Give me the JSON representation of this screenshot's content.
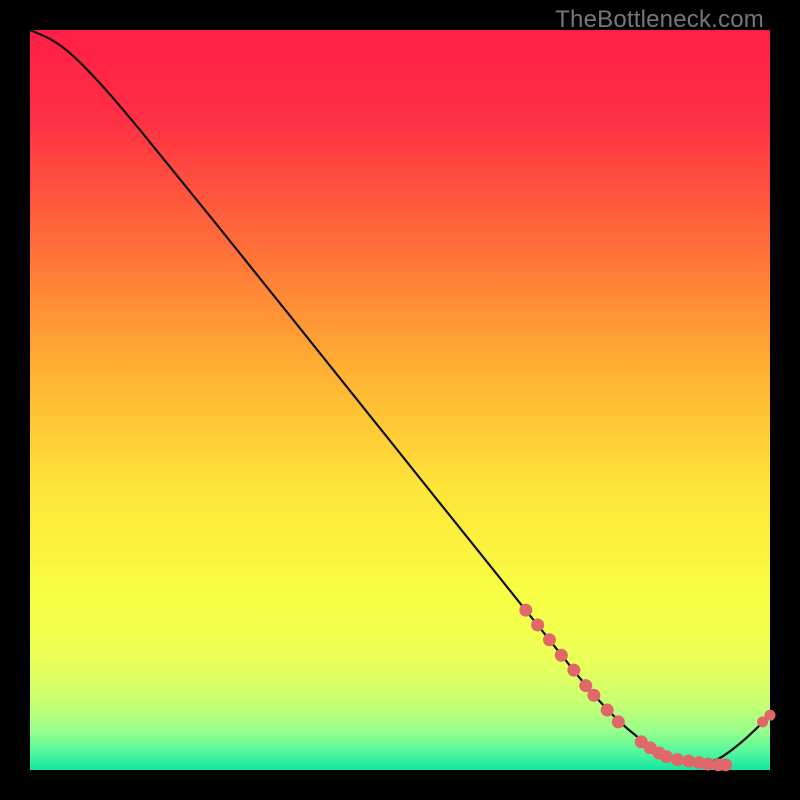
{
  "watermark": "TheBottleneck.com",
  "chart_data": {
    "type": "line",
    "title": "",
    "xlabel": "",
    "ylabel": "",
    "xlim": [
      0,
      100
    ],
    "ylim": [
      0,
      100
    ],
    "series": [
      {
        "name": "curve",
        "x": [
          0,
          3.5,
          7,
          12,
          20,
          30,
          40,
          50,
          60,
          67,
          72,
          76,
          80,
          84,
          88,
          92,
          96,
          100
        ],
        "y": [
          100,
          98.5,
          95.5,
          90,
          80.2,
          67.8,
          55.3,
          42.8,
          30.3,
          21.6,
          15.3,
          10.3,
          6.1,
          3.0,
          1.2,
          0.7,
          3.5,
          7.4
        ]
      }
    ],
    "markers_dense": {
      "name": "dense-cluster",
      "x": [
        67.0,
        68.6,
        70.2,
        71.8,
        73.5,
        75.1,
        76.2,
        78.0,
        79.5,
        82.6,
        83.8,
        85.0,
        86.0,
        87.5,
        89.0,
        90.4,
        91.6,
        93.0,
        94.0
      ],
      "y": [
        21.6,
        19.6,
        17.6,
        15.5,
        13.5,
        11.4,
        10.1,
        8.1,
        6.5,
        3.8,
        3.0,
        2.3,
        1.8,
        1.4,
        1.2,
        1.0,
        0.8,
        0.7,
        0.7
      ]
    },
    "markers_tail": {
      "name": "tail-points",
      "x": [
        99.0,
        100.0
      ],
      "y": [
        6.5,
        7.4
      ]
    },
    "gradient_stops": [
      {
        "pos": 0.0,
        "color": "#ff1e47"
      },
      {
        "pos": 0.12,
        "color": "#ff2f44"
      },
      {
        "pos": 0.28,
        "color": "#ff6a3a"
      },
      {
        "pos": 0.45,
        "color": "#ffad33"
      },
      {
        "pos": 0.62,
        "color": "#ffe539"
      },
      {
        "pos": 0.77,
        "color": "#f8ff44"
      },
      {
        "pos": 0.855,
        "color": "#eaff59"
      },
      {
        "pos": 0.905,
        "color": "#caff70"
      },
      {
        "pos": 0.945,
        "color": "#9dff8a"
      },
      {
        "pos": 0.975,
        "color": "#55f79c"
      },
      {
        "pos": 1.0,
        "color": "#11e8a1"
      }
    ],
    "marker_color": "#e06868",
    "curve_color": "#111111"
  }
}
